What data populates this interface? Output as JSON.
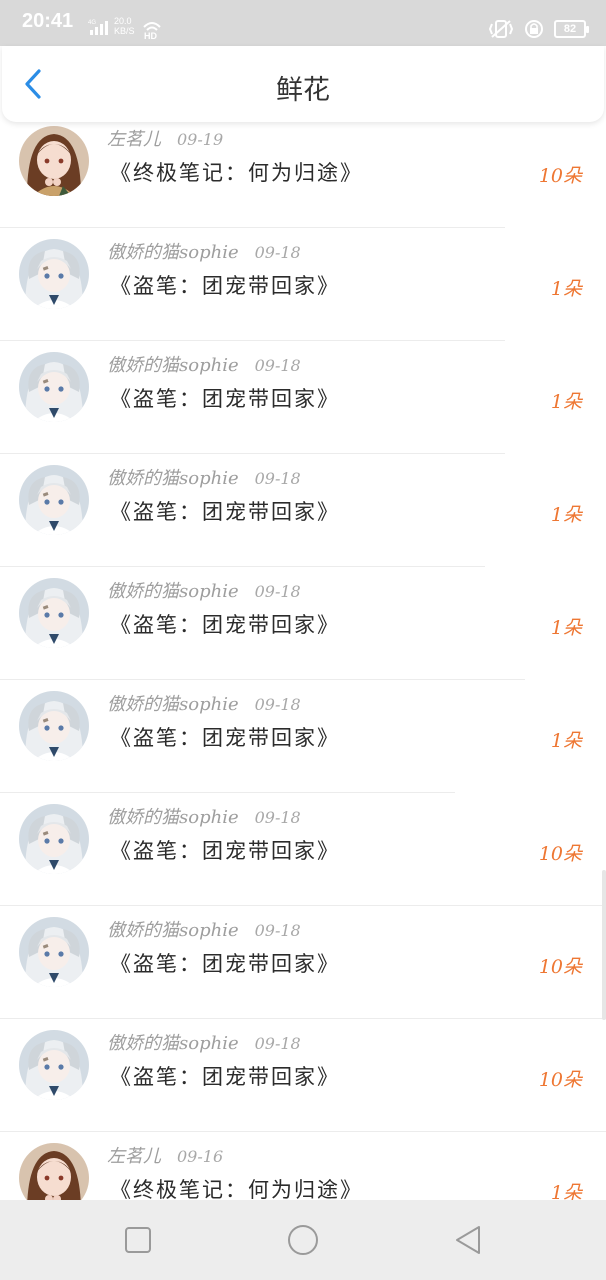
{
  "status": {
    "time": "20:41",
    "net_speed_top": "20.0",
    "net_speed_bottom": "KB/S",
    "network": "4G",
    "battery": "82"
  },
  "header": {
    "title": "鲜花"
  },
  "colors": {
    "accent": "#2b8de6",
    "count": "#ee7733"
  },
  "items": [
    {
      "user": "左茗儿",
      "date": "09-19",
      "book": "《终极笔记：何为归途》",
      "count": "10朵",
      "avatar": "girl-brown"
    },
    {
      "user": "傲娇的猫sophie",
      "date": "09-18",
      "book": "《盗笔：团宠带回家》",
      "count": "1朵",
      "avatar": "silver-hair"
    },
    {
      "user": "傲娇的猫sophie",
      "date": "09-18",
      "book": "《盗笔：团宠带回家》",
      "count": "1朵",
      "avatar": "silver-hair"
    },
    {
      "user": "傲娇的猫sophie",
      "date": "09-18",
      "book": "《盗笔：团宠带回家》",
      "count": "1朵",
      "avatar": "silver-hair"
    },
    {
      "user": "傲娇的猫sophie",
      "date": "09-18",
      "book": "《盗笔：团宠带回家》",
      "count": "1朵",
      "avatar": "silver-hair"
    },
    {
      "user": "傲娇的猫sophie",
      "date": "09-18",
      "book": "《盗笔：团宠带回家》",
      "count": "1朵",
      "avatar": "silver-hair"
    },
    {
      "user": "傲娇的猫sophie",
      "date": "09-18",
      "book": "《盗笔：团宠带回家》",
      "count": "10朵",
      "avatar": "silver-hair"
    },
    {
      "user": "傲娇的猫sophie",
      "date": "09-18",
      "book": "《盗笔：团宠带回家》",
      "count": "10朵",
      "avatar": "silver-hair"
    },
    {
      "user": "傲娇的猫sophie",
      "date": "09-18",
      "book": "《盗笔：团宠带回家》",
      "count": "10朵",
      "avatar": "silver-hair"
    },
    {
      "user": "左茗儿",
      "date": "09-16",
      "book": "《终极笔记：何为归途》",
      "count": "1朵",
      "avatar": "girl-brown"
    }
  ],
  "nav": {
    "icons": [
      "recent-apps-icon",
      "home-icon",
      "back-icon"
    ]
  }
}
